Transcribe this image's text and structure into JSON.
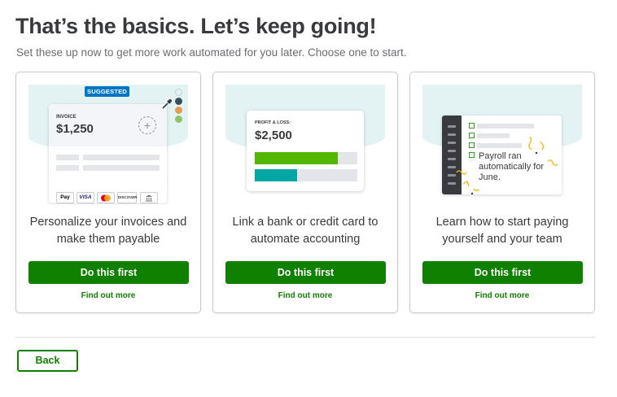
{
  "page": {
    "title": "That’s the basics. Let’s keep going!",
    "subtitle": "Set these up now to get more work automated for you later. Choose one to start."
  },
  "cards": [
    {
      "badge": "SUGGESTED",
      "invoice_label": "INVOICE",
      "invoice_amount": "$1,250",
      "plus": "+",
      "payment_methods": [
        "Pay",
        "VISA",
        "",
        "DISCOVER",
        ""
      ],
      "swatch_colors": [
        "#ffffff",
        "#34515b",
        "#e29d53",
        "#8fc46a"
      ],
      "description": "Personalize your invoices and make them payable",
      "button": "Do this first",
      "link": "Find out more"
    },
    {
      "pl_label": "PROFIT & LOSS:",
      "pl_amount": "$2,500",
      "bars": [
        {
          "color": "#53b700",
          "fill": 0.81
        },
        {
          "color": "#00a6a4",
          "fill": 0.41
        }
      ],
      "description": "Link a bank or credit card to automate accounting",
      "button": "Do this first",
      "link": "Find out more"
    },
    {
      "payroll_note": "Payroll ran automatically for June.",
      "description": "Learn how to start paying yourself and your team",
      "button": "Do this first",
      "link": "Find out more"
    }
  ],
  "footer": {
    "back": "Back"
  },
  "colors": {
    "primary": "#108000",
    "badge": "#0077c5",
    "band": "#e3f3f4"
  }
}
